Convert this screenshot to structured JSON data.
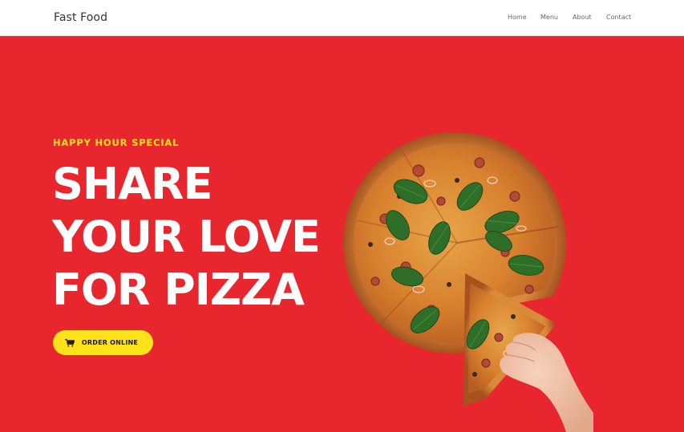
{
  "header": {
    "brand": "Fast Food",
    "nav": [
      "Home",
      "Menu",
      "About",
      "Contact"
    ]
  },
  "hero": {
    "eyebrow": "HAPPY HOUR SPECIAL",
    "headline": [
      "SHARE",
      "YOUR LOVE",
      "FOR PIZZA"
    ],
    "cta_label": "ORDER ONLINE",
    "cta_icon": "cart-icon",
    "image": "pizza-with-hand-holding-slice"
  },
  "colors": {
    "hero_background": "#e8262e",
    "accent_yellow": "#ffe21a",
    "headline_text": "#ffffff",
    "nav_text": "#666666"
  }
}
